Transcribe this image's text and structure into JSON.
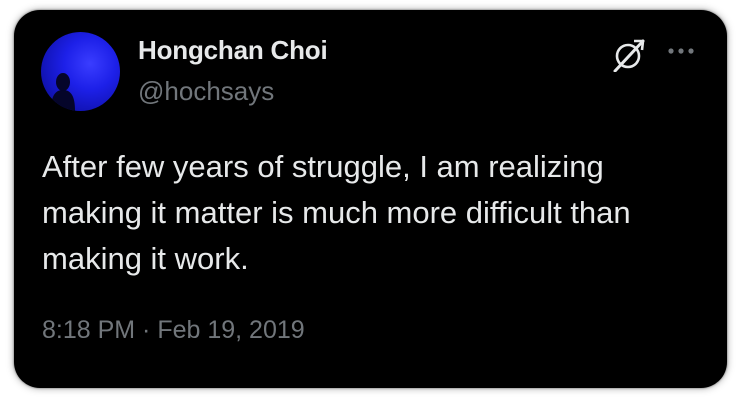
{
  "author": {
    "name": "Hongchan Choi",
    "handle": "@hochsays",
    "avatar": "silhouette-on-blue-avatar"
  },
  "header_icons": {
    "brand": "x-logo-icon",
    "menu": "more-options-icon"
  },
  "tweet": {
    "text": "After few years of struggle, I am realizing making it matter is much more difficult than making it work.",
    "timestamp": "8:18 PM · Feb 19, 2019"
  },
  "colors": {
    "card_background": "#000000",
    "primary_text": "#e7e9ea",
    "secondary_text": "#71767b",
    "avatar_blue": "#1d20e8"
  }
}
